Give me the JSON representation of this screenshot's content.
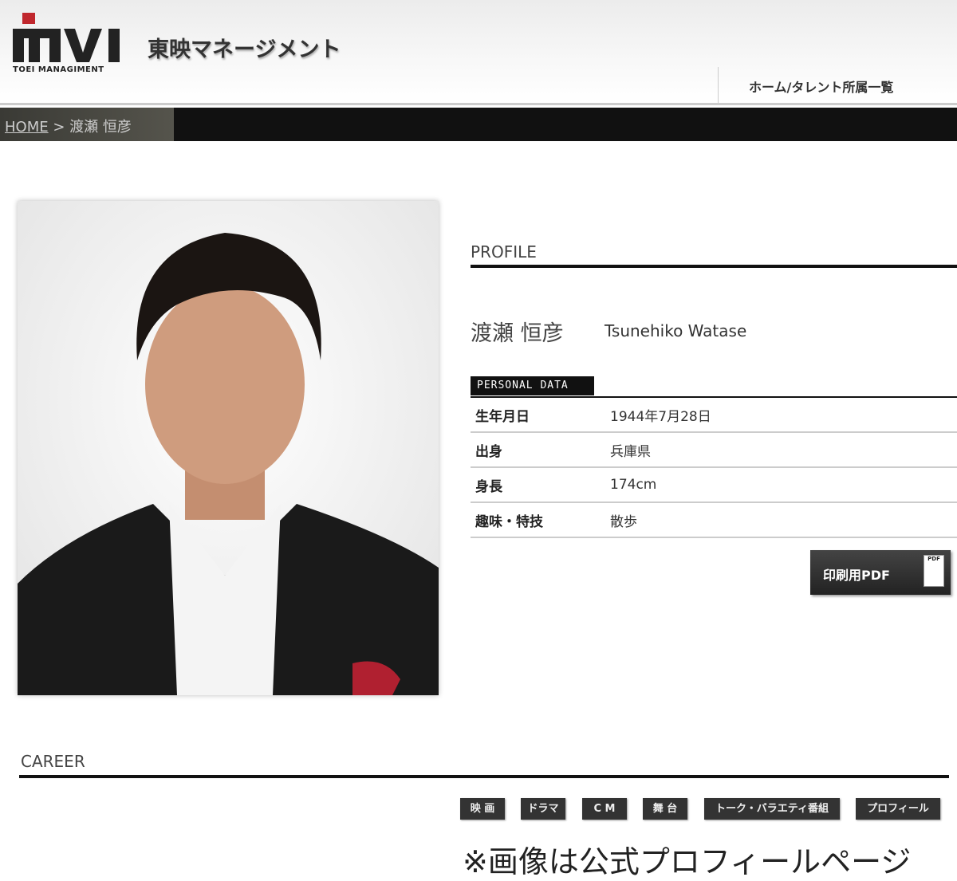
{
  "header": {
    "logo_text": "TOEI MANAGIMENT",
    "brand": "東映マネージメント",
    "nav_link": "ホーム/タレント所属一覧"
  },
  "breadcrumb": {
    "home": "HOME",
    "sep": ">",
    "current": "渡瀬 恒彦"
  },
  "profile": {
    "section_title": "PROFILE",
    "name_jp": "渡瀬 恒彦",
    "name_en": "Tsunehiko Watase",
    "personal_data_label": "PERSONAL DATA",
    "rows": [
      {
        "key": "生年月日",
        "value": "1944年7月28日"
      },
      {
        "key": "出身",
        "value": "兵庫県"
      },
      {
        "key": "身長",
        "value": "174cm"
      },
      {
        "key": "趣味・特技",
        "value": "散歩"
      }
    ],
    "pdf_button": "印刷用PDF",
    "pdf_icon_label": "PDF"
  },
  "career": {
    "section_title": "CAREER",
    "tabs": [
      "映 画",
      "ドラマ",
      "C M",
      "舞 台",
      "トーク・バラエティ番組",
      "プロフィール"
    ]
  },
  "caption": "※画像は公式プロフィールページ"
}
